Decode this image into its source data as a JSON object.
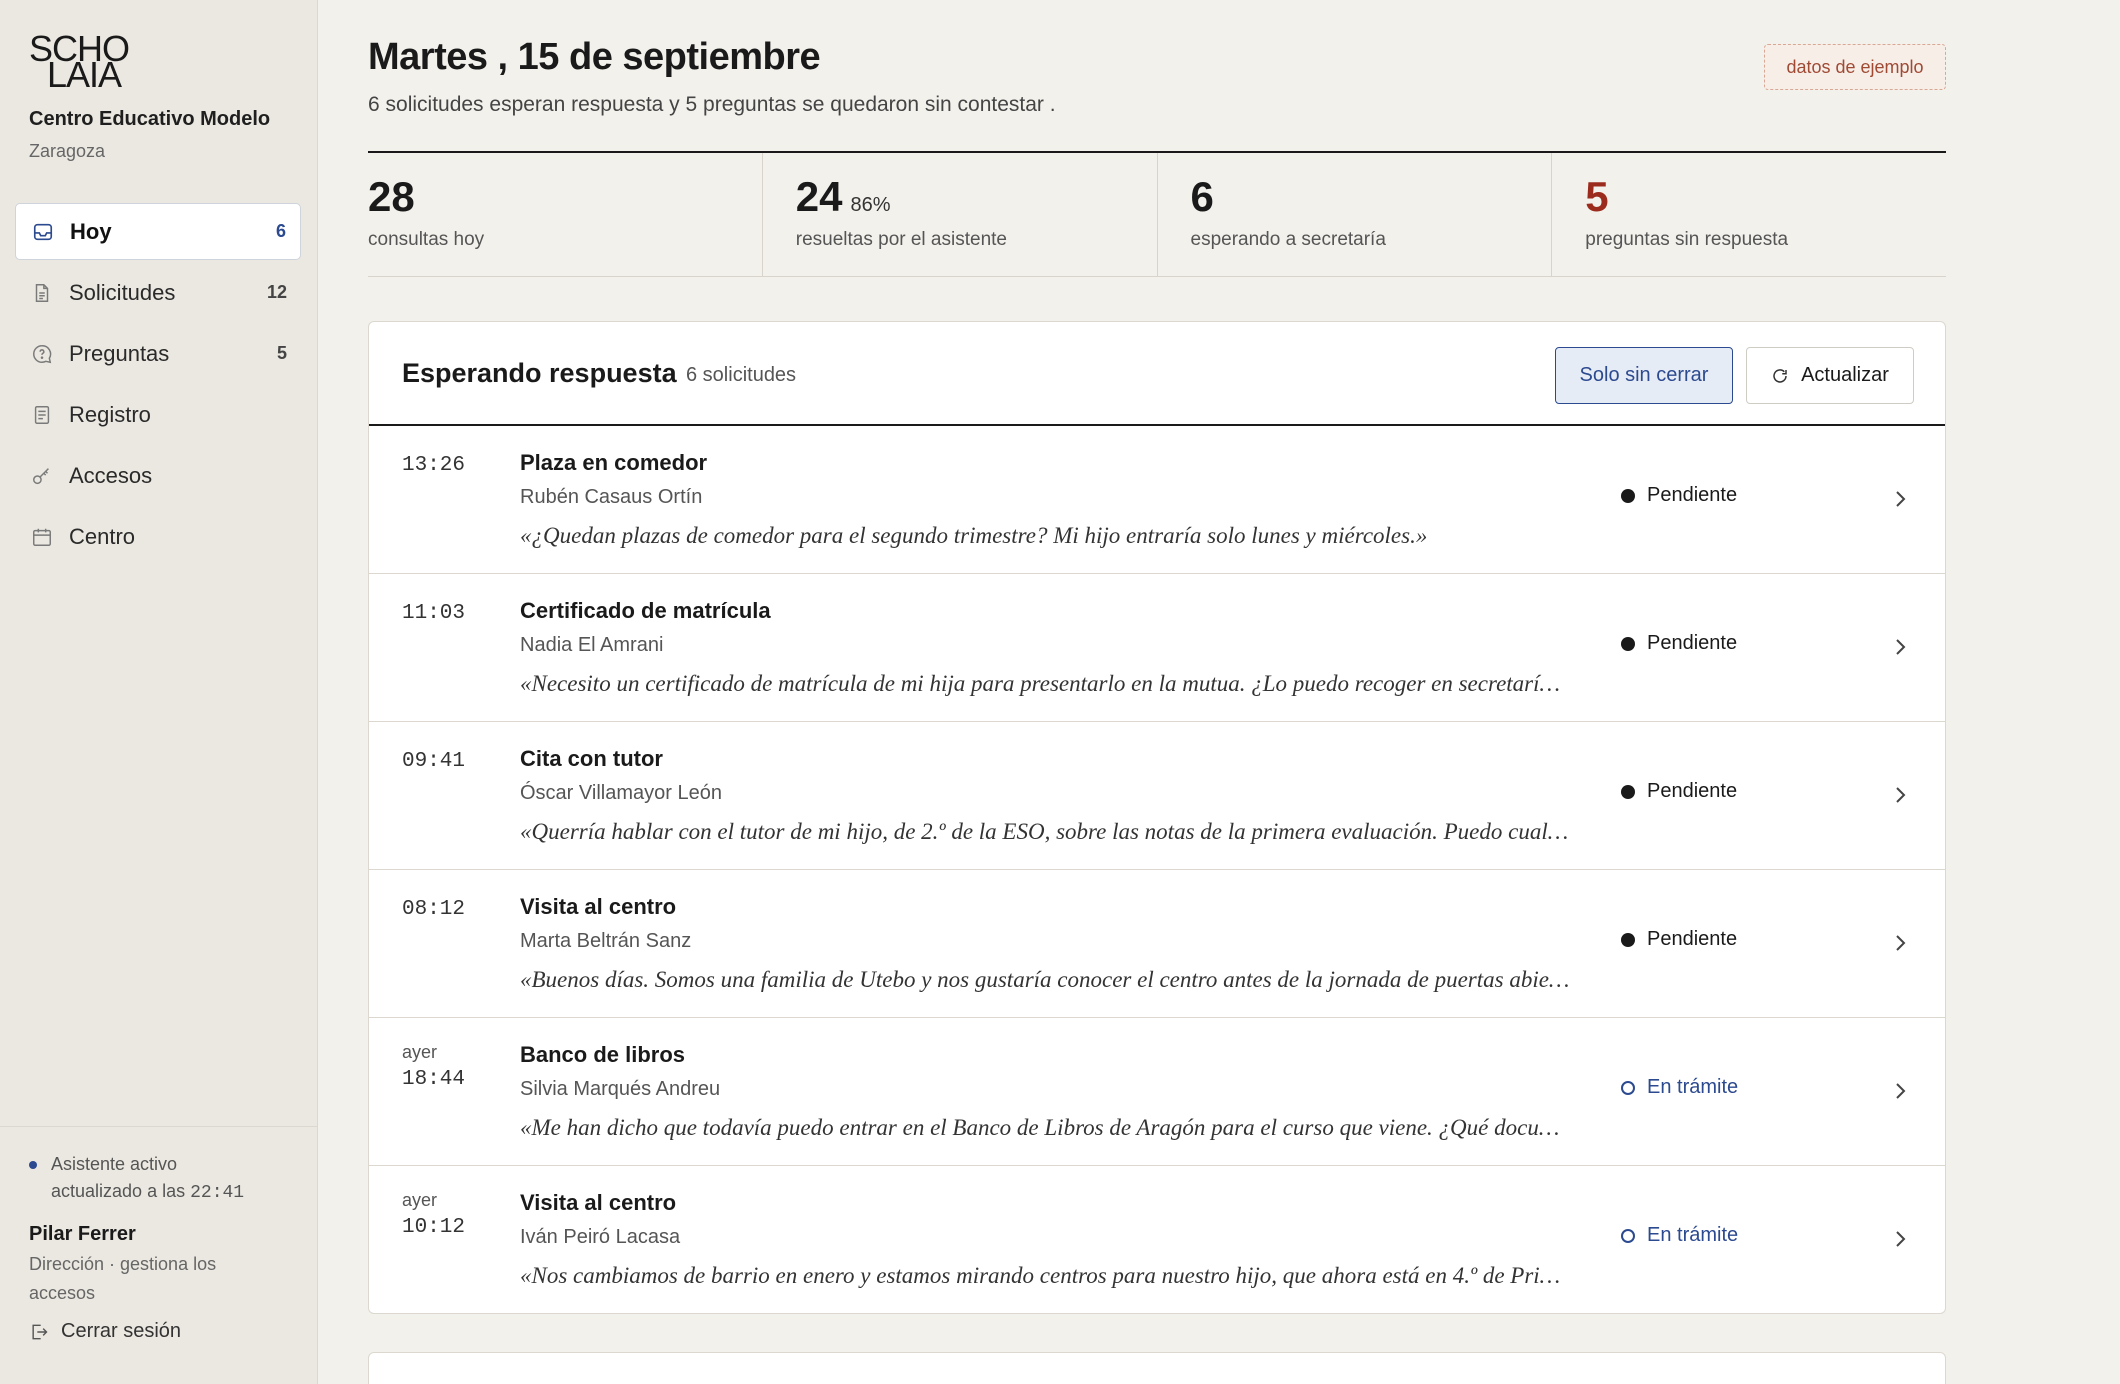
{
  "brand": {
    "logo_line1": "SCHO",
    "logo_line2": "LAIA",
    "org_name": "Centro Educativo Modelo",
    "org_city": "Zaragoza"
  },
  "nav": [
    {
      "label": "Hoy",
      "count": "6",
      "icon": "inbox-icon"
    },
    {
      "label": "Solicitudes",
      "count": "12",
      "icon": "document-icon"
    },
    {
      "label": "Preguntas",
      "count": "5",
      "icon": "chat-question-icon"
    },
    {
      "label": "Registro",
      "count": "",
      "icon": "ledger-icon"
    },
    {
      "label": "Accesos",
      "count": "",
      "icon": "key-icon"
    },
    {
      "label": "Centro",
      "count": "",
      "icon": "calendar-icon"
    }
  ],
  "footer": {
    "status_line1": "Asistente activo",
    "status_line2_prefix": "actualizado a las ",
    "status_time": "22:41",
    "user_name": "Pilar Ferrer",
    "user_role": "Dirección · gestiona los accesos",
    "logout_label": "Cerrar sesión"
  },
  "header": {
    "title": "Martes , 15 de septiembre",
    "subtitle": "6 solicitudes esperan respuesta y 5 preguntas se quedaron sin contestar .",
    "badge": "datos de ejemplo"
  },
  "stats": [
    {
      "value": "28",
      "pct": "",
      "label": "consultas hoy"
    },
    {
      "value": "24",
      "pct": "86%",
      "label": "resueltas por el asistente"
    },
    {
      "value": "6",
      "pct": "",
      "label": "esperando a secretaría"
    },
    {
      "value": "5",
      "pct": "",
      "label": "preguntas sin respuesta"
    }
  ],
  "panel": {
    "title": "Esperando respuesta",
    "count": "6 solicitudes",
    "filter_label": "Solo sin cerrar",
    "refresh_label": "Actualizar"
  },
  "requests": [
    {
      "day": "",
      "time": "13:26",
      "subject": "Plaza en comedor",
      "name": "Rubén Casaus Ortín",
      "quote": "«¿Quedan plazas de comedor para el segundo trimestre? Mi hijo entraría solo lunes y miércoles.»",
      "status": "Pendiente"
    },
    {
      "day": "",
      "time": "11:03",
      "subject": "Certificado de matrícula",
      "name": "Nadia El Amrani",
      "quote": "«Necesito un certificado de matrícula de mi hija para presentarlo en la mutua. ¿Lo puedo recoger en secretarí…",
      "status": "Pendiente"
    },
    {
      "day": "",
      "time": "09:41",
      "subject": "Cita con tutor",
      "name": "Óscar Villamayor León",
      "quote": "«Querría hablar con el tutor de mi hijo, de 2.º de la ESO, sobre las notas de la primera evaluación. Puedo cual…",
      "status": "Pendiente"
    },
    {
      "day": "",
      "time": "08:12",
      "subject": "Visita al centro",
      "name": "Marta Beltrán Sanz",
      "quote": "«Buenos días. Somos una familia de Utebo y nos gustaría conocer el centro antes de la jornada de puertas abie…",
      "status": "Pendiente"
    },
    {
      "day": "ayer",
      "time": "18:44",
      "subject": "Banco de libros",
      "name": "Silvia Marqués Andreu",
      "quote": "«Me han dicho que todavía puedo entrar en el Banco de Libros de Aragón para el curso que viene. ¿Qué docu…",
      "status": "En trámite"
    },
    {
      "day": "ayer",
      "time": "10:12",
      "subject": "Visita al centro",
      "name": "Iván Peiró Lacasa",
      "quote": "«Nos cambiamos de barrio en enero y estamos mirando centros para nuestro hijo, que ahora está en 4.º de Pri…",
      "status": "En trámite"
    }
  ],
  "colors": {
    "accent": "#2c4a8f",
    "alert": "#9b2c1d",
    "background": "#f3f1ec",
    "sidebar": "#ebe8e1"
  }
}
